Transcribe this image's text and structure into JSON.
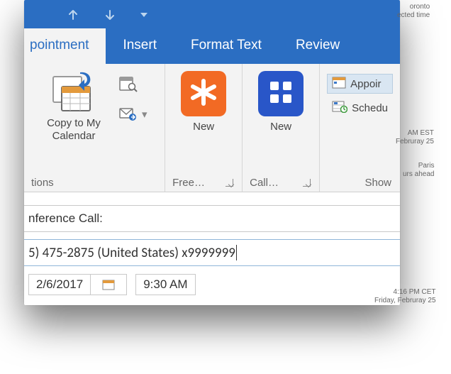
{
  "qat": {
    "up_arrow": "up-arrow-icon",
    "down_arrow": "down-arrow-icon",
    "dropdown": "qat-dropdown-icon"
  },
  "tabs": [
    {
      "label": "pointment",
      "active": true
    },
    {
      "label": "Insert"
    },
    {
      "label": "Format Text"
    },
    {
      "label": "Review"
    }
  ],
  "ribbon": {
    "group_actions": {
      "copy_label_line1": "Copy to My",
      "copy_label_line2": "Calendar",
      "footer": "tions"
    },
    "group_free": {
      "new_label": "New",
      "footer": "Free…"
    },
    "group_call": {
      "new_label": "New",
      "footer": "Call…"
    },
    "group_show": {
      "appointment_label": "Appoir",
      "scheduling_label": "Schedu",
      "footer": "Show"
    }
  },
  "fields": {
    "subject": "nference Call:",
    "location": "5) 475-2875 (United States) x9999999",
    "date": "2/6/2017",
    "time": "9:30 AM"
  },
  "external": {
    "tz1_line1": "oronto",
    "tz1_line2": "ected time",
    "tz2_line1": "AM EST",
    "tz2_line2": "Februray 25",
    "tz3_line1": "Paris",
    "tz3_line2": "urs ahead",
    "tz4_line1": "4:16 PM CET",
    "tz4_line2": "Friday, Februray 25"
  }
}
